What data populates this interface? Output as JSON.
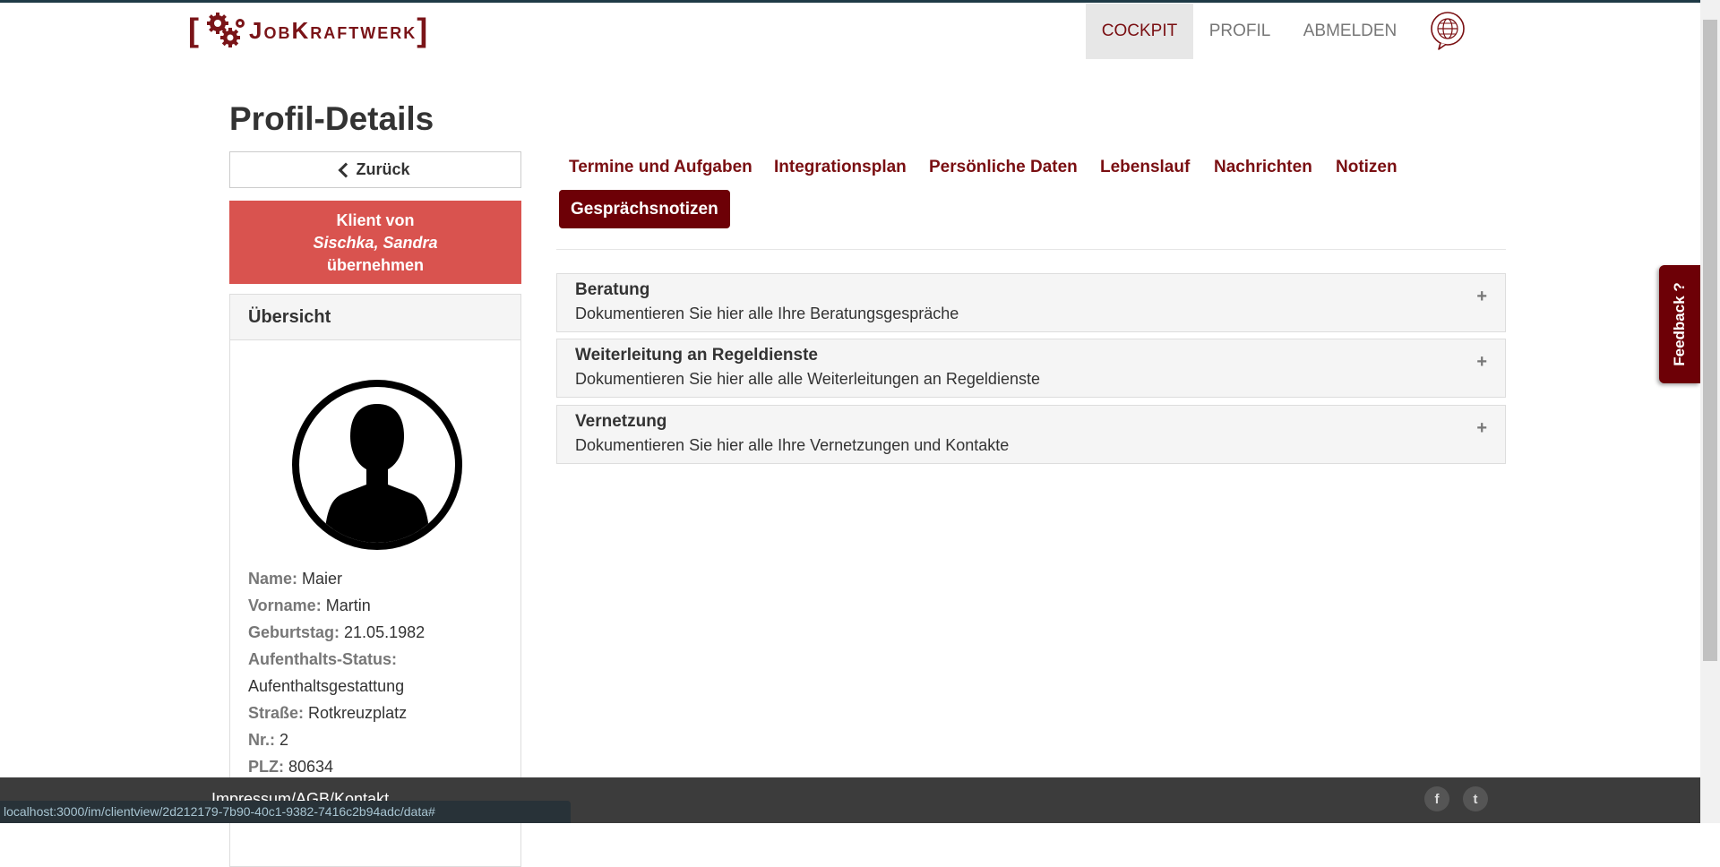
{
  "header": {
    "logo_text": "[JobKraftwerk]",
    "nav": [
      {
        "label": "COCKPIT",
        "active": true
      },
      {
        "label": "PROFIL",
        "active": false
      },
      {
        "label": "ABMELDEN",
        "active": false
      }
    ]
  },
  "page": {
    "title": "Profil-Details"
  },
  "sidebar": {
    "back_label": "Zurück",
    "klient_line1": "Klient von",
    "klient_line2": "Sischka, Sandra",
    "klient_line3": "übernehmen",
    "panel_title": "Übersicht",
    "fields": [
      {
        "label": "Name:",
        "value": "Maier"
      },
      {
        "label": "Vorname:",
        "value": "Martin"
      },
      {
        "label": "Geburtstag:",
        "value": "21.05.1982"
      },
      {
        "label": "Aufenthalts-Status:",
        "value": "Aufenthaltsgestattung"
      },
      {
        "label": "Straße:",
        "value": "Rotkreuzplatz"
      },
      {
        "label": "Nr.:",
        "value": "2"
      },
      {
        "label": "PLZ:",
        "value": "80634"
      }
    ]
  },
  "tabs": [
    {
      "label": "Termine und Aufgaben"
    },
    {
      "label": "Integrationsplan"
    },
    {
      "label": "Persönliche Daten"
    },
    {
      "label": "Lebenslauf"
    },
    {
      "label": "Nachrichten"
    },
    {
      "label": "Notizen"
    },
    {
      "label": "Gesprächsnotizen",
      "active": true
    }
  ],
  "accordion": [
    {
      "title": "Beratung",
      "desc": "Dokumentieren Sie hier alle Ihre Beratungsgespräche",
      "icon": "+"
    },
    {
      "title": "Weiterleitung an Regeldienste",
      "desc": "Dokumentieren Sie hier alle alle Weiterleitungen an Regeldienste",
      "icon": "+"
    },
    {
      "title": "Vernetzung",
      "desc": "Dokumentieren Sie hier alle Ihre Vernetzungen und Kontakte",
      "icon": "+"
    }
  ],
  "feedback_label": "Feedback ?",
  "footer": {
    "links": "Impressum/AGB/Kontakt",
    "social": [
      "f",
      "t"
    ]
  },
  "status_url": "localhost:3000/im/clientview/2d212179-7b90-40c1-9382-7416c2b94adc/data#",
  "colors": {
    "brand": "#7a0f12",
    "brand_dark": "#6d0006",
    "danger": "#d9534f",
    "footer": "#3c3c3c"
  }
}
